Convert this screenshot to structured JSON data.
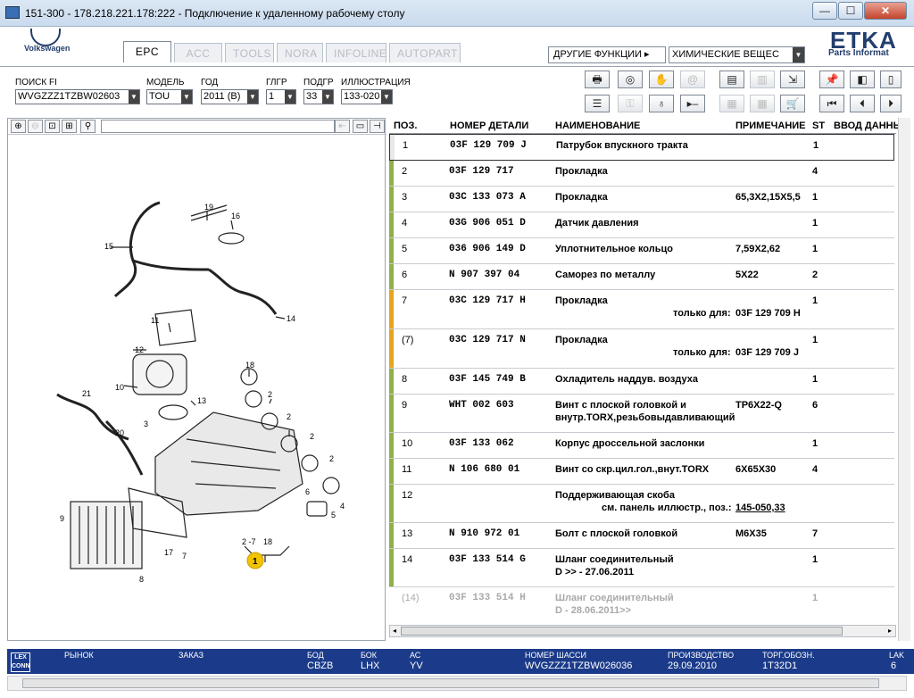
{
  "window": {
    "title": "151-300 - 178.218.221.178:222 - Подключение к удаленному рабочему столу",
    "min_label": "—",
    "max_label": "☐",
    "close_label": "✕"
  },
  "header": {
    "brand": "Volkswagen",
    "etka": "ETKA",
    "etka_sub": "Parts Informat",
    "tabs": [
      "EPC",
      "ACC",
      "TOOLS",
      "NORA",
      "INFOLINE",
      "AUTOPART"
    ],
    "other_functions": "ДРУГИЕ ФУНКЦИИ ▸",
    "chem_select": "ХИМИЧЕСКИЕ ВЕЩЕС"
  },
  "filters": {
    "search_fi_label": "ПОИСК FI",
    "search_fi_value": "WVGZZZ1TZBW02603",
    "model_label": "МОДЕЛЬ",
    "model_value": "TOU",
    "year_label": "ГОД",
    "year_value": "2011 (B)",
    "hg_label": "ГЛГР",
    "hg_value": "1",
    "sg_label": "ПОДГР",
    "sg_value": "33",
    "illus_label": "ИЛЛЮСТРАЦИЯ",
    "illus_value": "133-020"
  },
  "table": {
    "headers": {
      "pos": "ПОЗ.",
      "part_no": "НОМЕР ДЕТАЛИ",
      "name": "НАИМЕНОВАНИЕ",
      "note": "ПРИМЕЧАНИЕ",
      "st": "ST",
      "input": "ВВОД ДАННЫ"
    },
    "only_for": "только для:",
    "rows": [
      {
        "pos": "1",
        "num": "03F 129 709 J",
        "name": "Патрубок впускного тракта",
        "name2": "",
        "note": "",
        "st": "1"
      },
      {
        "pos": "2",
        "num": "03F 129 717",
        "name": "Прокладка",
        "name2": "",
        "note": "",
        "st": "4"
      },
      {
        "pos": "3",
        "num": "03C 133 073 A",
        "name": "Прокладка",
        "name2": "",
        "note": "65,3X2,15X5,5",
        "st": "1"
      },
      {
        "pos": "4",
        "num": "03G 906 051 D",
        "name": "Датчик давления",
        "name2": "",
        "note": "",
        "st": "1"
      },
      {
        "pos": "5",
        "num": "036 906 149 D",
        "name": "Уплотнительное кольцо",
        "name2": "",
        "note": "7,59X2,62",
        "st": "1"
      },
      {
        "pos": "6",
        "num": "N   907 397 04",
        "name": "Саморез по металлу",
        "name2": "",
        "note": "5X22",
        "st": "2"
      },
      {
        "pos": "7",
        "num": "03C 129 717 H",
        "name": "Прокладка",
        "name2": "",
        "note": "",
        "st": "1",
        "only_value": "03F 129 709 H"
      },
      {
        "pos": "(7)",
        "num": "03C 129 717 N",
        "name": "Прокладка",
        "name2": "",
        "note": "",
        "st": "1",
        "only_value": "03F 129 709 J"
      },
      {
        "pos": "8",
        "num": "03F 145 749 B",
        "name": "Охладитель наддув. воздуха",
        "name2": "",
        "note": "",
        "st": "1"
      },
      {
        "pos": "9",
        "num": "WHT 002 603",
        "name": "Винт с плоской головкой и",
        "name2": "внутр.TORX,резьбовыдавливающий",
        "note": "TP6X22-Q",
        "st": "6"
      },
      {
        "pos": "10",
        "num": "03F 133 062",
        "name": "Корпус дроссельной заслонки",
        "name2": "",
        "note": "",
        "st": "1"
      },
      {
        "pos": "11",
        "num": "N   106 680 01",
        "name": "Винт со скр.цил.гол.,внут.TORX",
        "name2": "",
        "note": "6X65X30",
        "st": "4"
      },
      {
        "pos": "12",
        "num": "",
        "name": "Поддерживающая скоба",
        "name2": "",
        "note": "",
        "st": "",
        "ref_text": "см. панель иллюстр., поз.:",
        "ref_link": "145-050,33"
      },
      {
        "pos": "13",
        "num": "N   910 972 01",
        "name": "Болт с плоской головкой",
        "name2": "",
        "note": "M6X35",
        "st": "7"
      },
      {
        "pos": "14",
        "num": "03F 133 514 G",
        "name": "Шланг соединительный",
        "name2": "D            >> - 27.06.2011",
        "note": "",
        "st": "1"
      },
      {
        "pos": "(14)",
        "num": "03F 133 514 H",
        "name": "Шланг соединительный",
        "name2": "D - 28.06.2011>>",
        "note": "",
        "st": "1"
      }
    ]
  },
  "illustration": {
    "callouts": [
      "19",
      "16",
      "15",
      "14",
      "11",
      "12",
      "10",
      "13",
      "18",
      "2",
      "2",
      "2",
      "2",
      "21",
      "3",
      "20",
      "6",
      "5",
      "4",
      "9",
      "17",
      "7",
      "8",
      "2 -7",
      "18",
      "1"
    ]
  },
  "statusbar": {
    "lex": "LEX CONN",
    "market_label": "РЫНОК",
    "order_label": "ЗАКАЗ",
    "bod_label": "БОД",
    "bod_value": "CBZB",
    "bok_label": "БОК",
    "bok_value": "LHX",
    "ac_label": "АС",
    "ac_value": "YV",
    "chassis_label": "НОМЕР ШАССИ",
    "chassis_value": "WVGZZZ1TZBW026036",
    "production_label": "ПРОИЗВОДСТВО",
    "production_value": "29.09.2010",
    "trade_label": "ТОРГ.ОБОЗН.",
    "trade_value": "1T32D1",
    "lak_label": "LAK",
    "lak_value": "6"
  },
  "colors": {
    "accent_bar_green": "#8fb04a",
    "accent_bar_orange": "#e5a51e",
    "statusbar_blue": "#1b3b8a",
    "callout_yellow": "#f2c300"
  }
}
